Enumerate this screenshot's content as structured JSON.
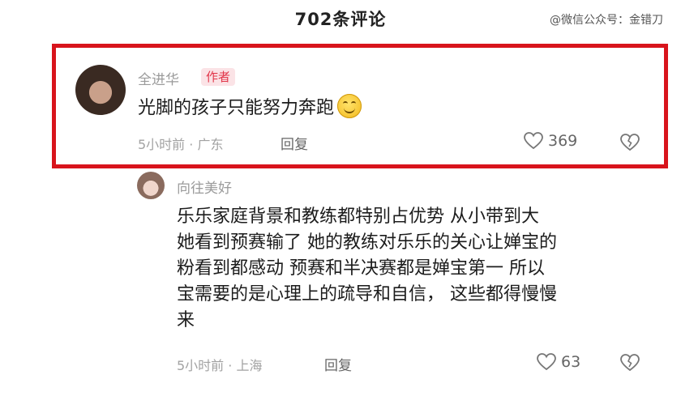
{
  "header": {
    "title": "702条评论",
    "watermark": "@微信公众号：金错刀"
  },
  "comments": [
    {
      "username": "全进华",
      "badge": "作者",
      "text": "光脚的孩子只能努力奔跑",
      "emoji_icon": "smile-emoji-icon",
      "meta": "5小时前 · 广东",
      "reply_label": "回复",
      "likes": "369",
      "highlighted": true,
      "highlight_color": "#d8141c"
    },
    {
      "username": "向往美好",
      "text_lines": [
        "乐乐家庭背景和教练都特别占优势 从小带到大",
        "她看到预赛输了 她的教练对乐乐的关心让婵宝的",
        "粉看到都感动 预赛和半决赛都是婵宝第一 所以",
        "宝需要的是心理上的疏导和自信， 这些都得慢慢",
        "来"
      ],
      "meta": "5小时前 · 上海",
      "reply_label": "回复",
      "likes": "63"
    }
  ],
  "icons": {
    "like": "heart-outline-icon",
    "dislike": "broken-heart-icon"
  }
}
